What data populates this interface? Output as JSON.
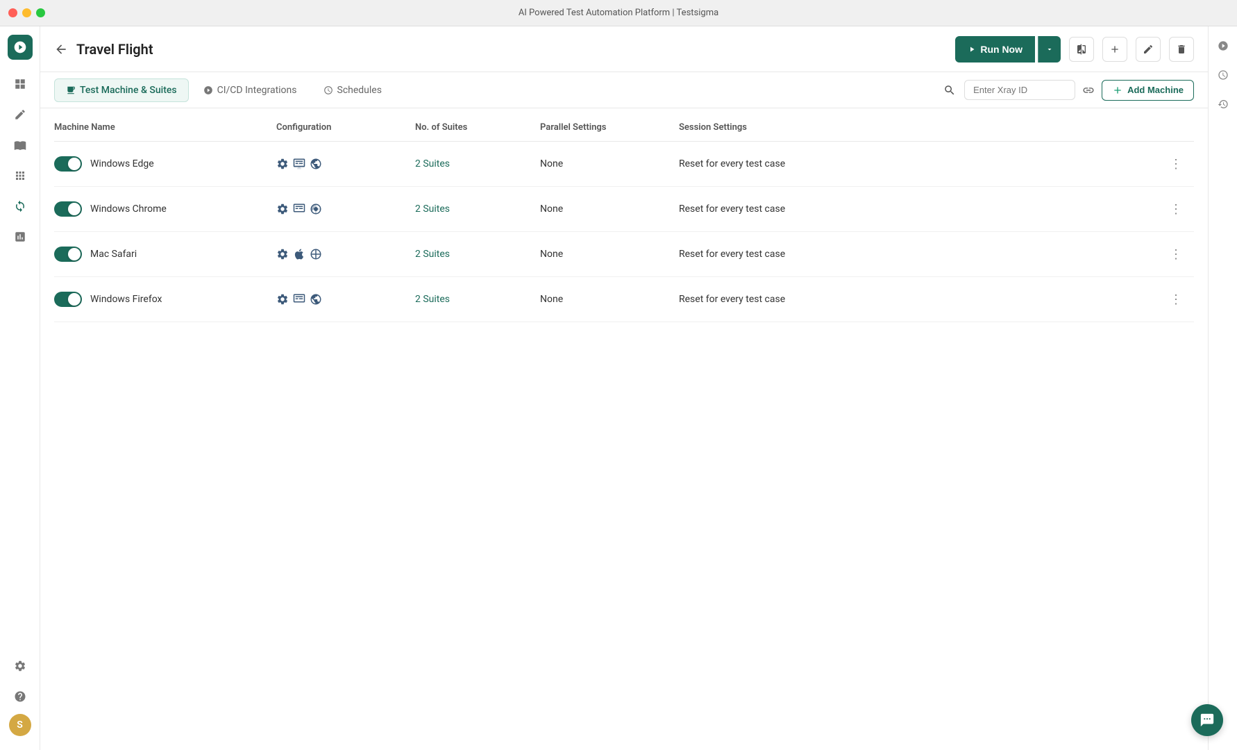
{
  "window": {
    "title": "AI Powered Test Automation Platform | Testsigma"
  },
  "header": {
    "back_label": "←",
    "page_title": "Travel Flight",
    "run_now_label": "Run Now",
    "run_now_icon": "▶"
  },
  "tabs": [
    {
      "id": "test-machine",
      "label": "Test Machine & Suites",
      "active": true,
      "icon": "▣"
    },
    {
      "id": "cicd",
      "label": "CI/CD Integrations",
      "active": false,
      "icon": "⊙"
    },
    {
      "id": "schedules",
      "label": "Schedules",
      "active": false,
      "icon": "⧖"
    }
  ],
  "toolbar": {
    "xray_placeholder": "Enter Xray ID",
    "add_machine_label": "Add Machine",
    "add_machine_prefix": "+"
  },
  "table": {
    "columns": [
      "Machine Name",
      "Configuration",
      "No. of Suites",
      "Parallel Settings",
      "Session Settings",
      ""
    ],
    "rows": [
      {
        "name": "Windows Edge",
        "enabled": true,
        "config_icons": [
          "⚙",
          "⊞",
          "⟳"
        ],
        "suites": "2 Suites",
        "parallel": "None",
        "session": "Reset for every test case"
      },
      {
        "name": "Windows Chrome",
        "enabled": true,
        "config_icons": [
          "⚙",
          "⊞",
          "🌐"
        ],
        "suites": "2 Suites",
        "parallel": "None",
        "session": "Reset for every test case"
      },
      {
        "name": "Mac Safari",
        "enabled": true,
        "config_icons": [
          "⚙",
          "",
          "◎"
        ],
        "suites": "2 Suites",
        "parallel": "None",
        "session": "Reset for every test case"
      },
      {
        "name": "Windows Firefox",
        "enabled": true,
        "config_icons": [
          "⚙",
          "⊞",
          "🔥"
        ],
        "suites": "2 Suites",
        "parallel": "None",
        "session": "Reset for every test case"
      }
    ]
  },
  "sidebar": {
    "logo_letter": "⚙",
    "items": [
      {
        "id": "grid",
        "icon": "⊞",
        "label": "Dashboard"
      },
      {
        "id": "pen",
        "icon": "✏",
        "label": "Test Cases"
      },
      {
        "id": "book",
        "icon": "📖",
        "label": "Test Plans"
      },
      {
        "id": "apps",
        "icon": "⊟",
        "label": "Apps"
      },
      {
        "id": "refresh",
        "icon": "↻",
        "label": "Test Runs"
      },
      {
        "id": "chart",
        "icon": "📊",
        "label": "Reports"
      },
      {
        "id": "settings",
        "icon": "⚙",
        "label": "Settings"
      }
    ],
    "help_icon": "?",
    "avatar_letter": "S"
  },
  "right_sidebar": {
    "items": [
      {
        "id": "info",
        "icon": "ℹ"
      },
      {
        "id": "clock",
        "icon": "🕐"
      },
      {
        "id": "history",
        "icon": "↺"
      }
    ]
  },
  "colors": {
    "brand_green": "#1b6b5a",
    "brand_green_light": "#eef7f4",
    "suites_color": "#1b6b5a",
    "add_machine_color": "#1b9e74"
  }
}
